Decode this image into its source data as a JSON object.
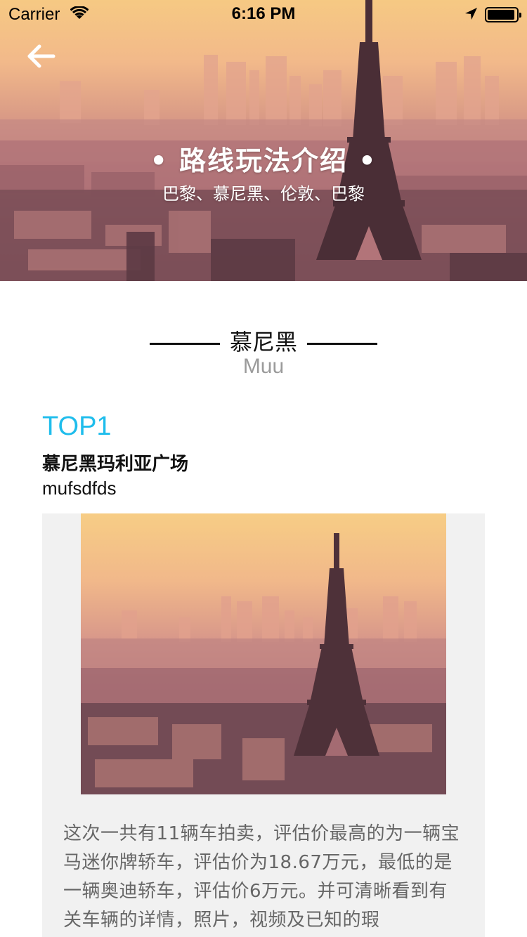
{
  "status_bar": {
    "carrier": "Carrier",
    "time": "6:16 PM",
    "battery_level": 0.95
  },
  "header": {
    "back_icon": "arrow-left-icon",
    "title": "• 路线玩法介绍 •",
    "subtitle": "巴黎、慕尼黑、伦敦、巴黎"
  },
  "section": {
    "title": "慕尼黑",
    "subtitle": "Muu"
  },
  "item": {
    "rank": "TOP1",
    "name": "慕尼黑玛利亚广场",
    "subname": "mufsdfds",
    "description": "这次一共有11辆车拍卖，评估价最高的为一辆宝马迷你牌轿车，评估价为18.67万元，最低的是一辆奥迪轿车，评估价6万元。并可清晰看到有关车辆的详情，照片，视频及已知的瑕"
  },
  "colors": {
    "accent": "#1fbdec",
    "card_background": "#f1f1f1",
    "muted_text": "#9b9b9b"
  }
}
